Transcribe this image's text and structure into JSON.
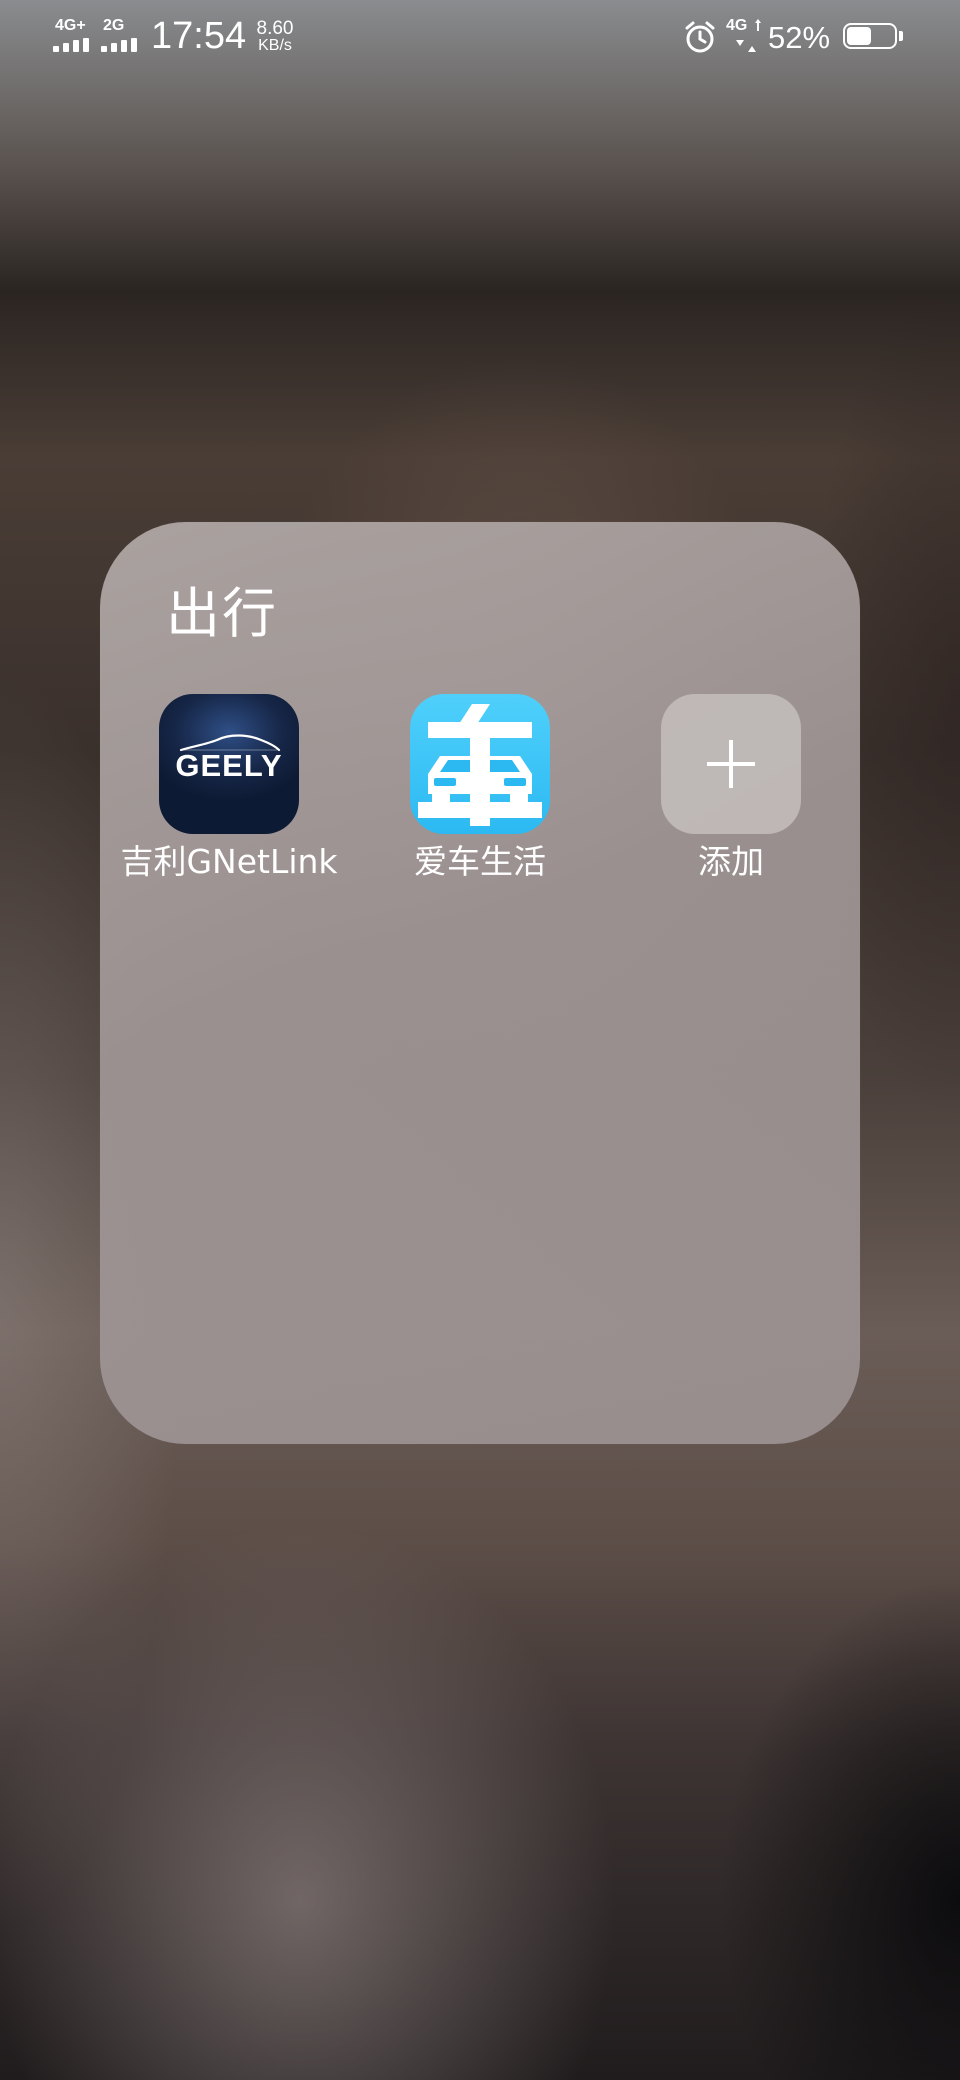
{
  "status_bar": {
    "network_left_1": "4G+",
    "network_left_2": "2G",
    "time": "17:54",
    "speed_value": "8.60",
    "speed_unit": "KB/s",
    "network_right": "4G",
    "battery_percent": "52%",
    "battery_level": 0.52
  },
  "folder": {
    "title": "出行",
    "apps": [
      {
        "label": "吉利GNetLink",
        "icon": "geely-icon",
        "icon_text": "GEELY"
      },
      {
        "label": "爱车生活",
        "icon": "car-life-icon",
        "icon_glyph": "车"
      },
      {
        "label": "添加",
        "icon": "plus-icon"
      }
    ]
  },
  "colors": {
    "geely_bg": "#162647",
    "car_life_bg": "#2cb9f2",
    "text": "#ffffff"
  }
}
